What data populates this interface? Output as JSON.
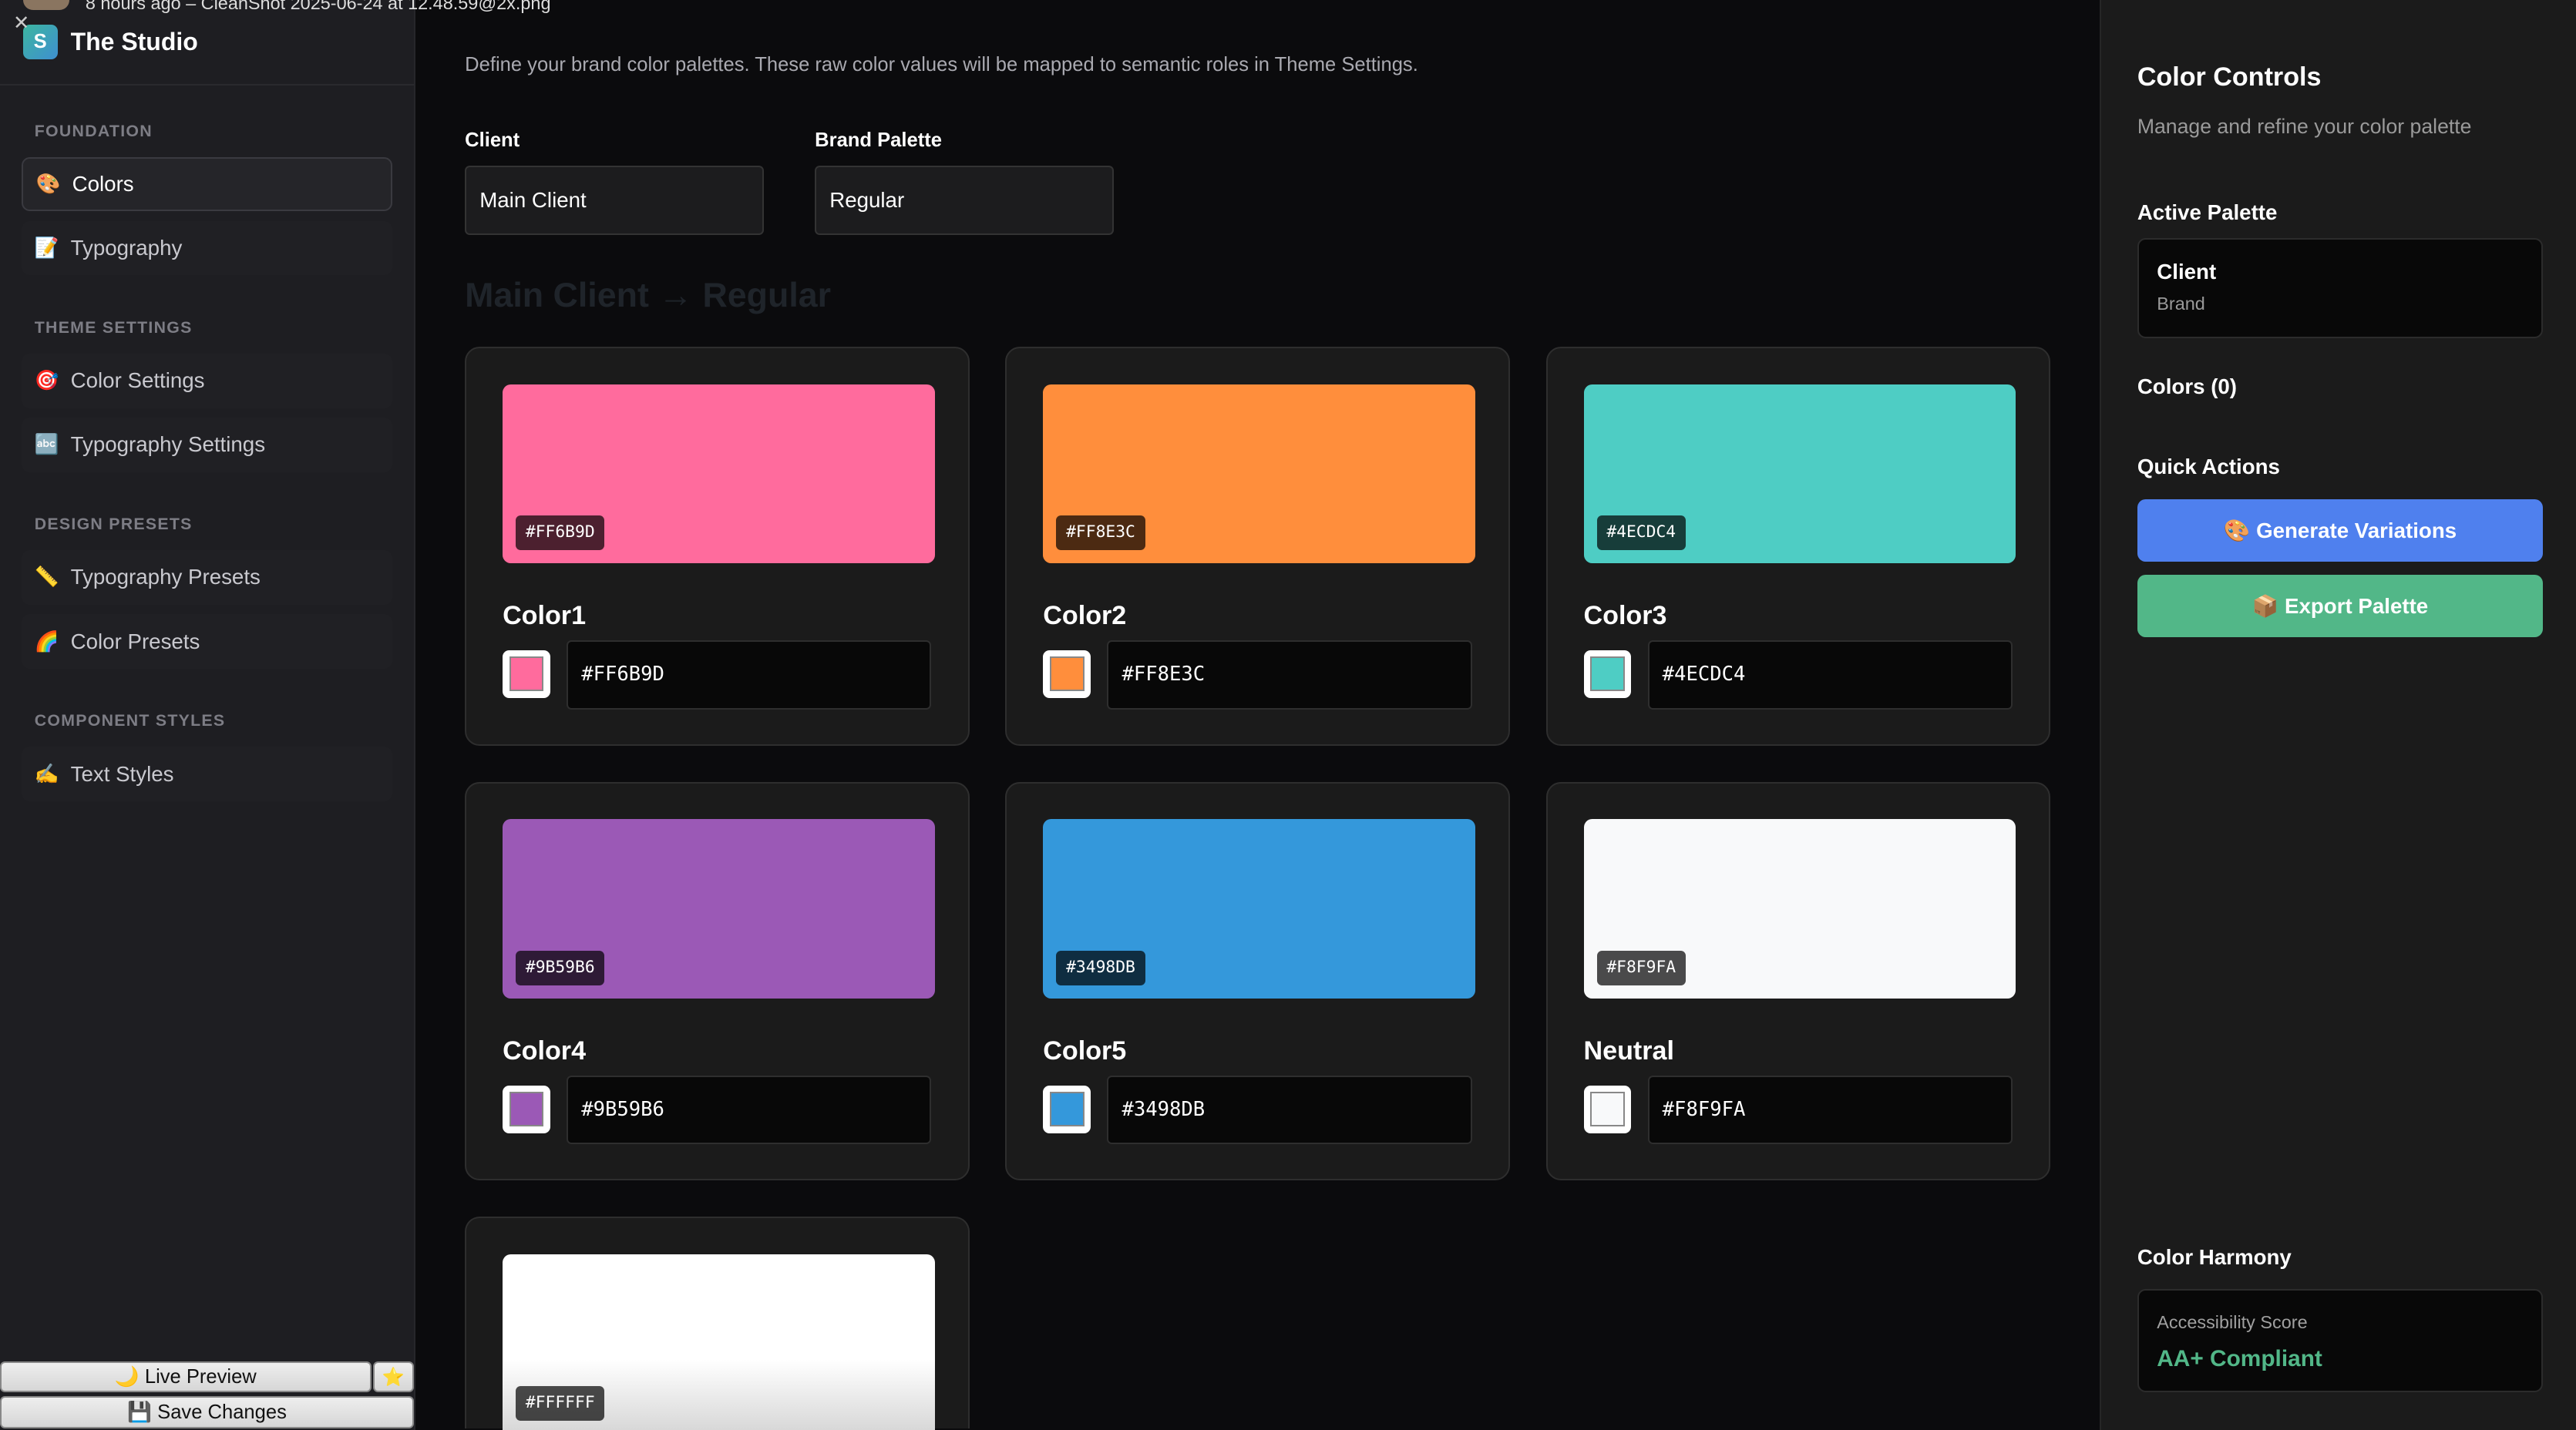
{
  "window": {
    "title": "8 hours ago – CleanShot 2025-06-24 at 12.48.59@2x.png"
  },
  "app": {
    "logo_letter": "S",
    "name": "The Studio"
  },
  "sidebar": {
    "sections": [
      {
        "title": "FOUNDATION",
        "items": [
          {
            "label": "Colors",
            "icon": "🎨",
            "icon_name": "palette-icon",
            "active": true
          },
          {
            "label": "Typography",
            "icon": "📝",
            "icon_name": "memo-icon"
          }
        ]
      },
      {
        "title": "THEME SETTINGS",
        "items": [
          {
            "label": "Color Settings",
            "icon": "🎯",
            "icon_name": "target-icon"
          },
          {
            "label": "Typography Settings",
            "icon": "🔤",
            "icon_name": "abc-icon"
          }
        ]
      },
      {
        "title": "DESIGN PRESETS",
        "items": [
          {
            "label": "Typography Presets",
            "icon": "📏",
            "icon_name": "ruler-icon"
          },
          {
            "label": "Color Presets",
            "icon": "🌈",
            "icon_name": "rainbow-icon"
          }
        ]
      },
      {
        "title": "COMPONENT STYLES",
        "items": [
          {
            "label": "Text Styles",
            "icon": "✍️",
            "icon_name": "writing-hand-icon"
          }
        ]
      }
    ],
    "live_preview": "🌙 Live Preview",
    "star": "⭐",
    "save": "💾 Save Changes"
  },
  "main": {
    "description": "Define your brand color palettes. These raw color values will be mapped to semantic roles in Theme Settings.",
    "client_label": "Client",
    "client_value": "Main Client",
    "palette_label": "Brand Palette",
    "palette_value": "Regular",
    "breadcrumb": "Main Client → Regular",
    "colors": [
      {
        "name": "Color1",
        "hex": "#FF6B9D"
      },
      {
        "name": "Color2",
        "hex": "#FF8E3C"
      },
      {
        "name": "Color3",
        "hex": "#4ECDC4"
      },
      {
        "name": "Color4",
        "hex": "#9B59B6"
      },
      {
        "name": "Color5",
        "hex": "#3498DB"
      },
      {
        "name": "Neutral",
        "hex": "#F8F9FA"
      },
      {
        "name": "",
        "hex": "#FFFFFF"
      }
    ]
  },
  "panel": {
    "title": "Color Controls",
    "subtitle": "Manage and refine your color palette",
    "active_palette_heading": "Active Palette",
    "active_palette_name": "Client",
    "active_palette_type": "Brand",
    "colors_count": "Colors (0)",
    "quick_actions": "Quick Actions",
    "generate": "🎨 Generate Variations",
    "export": "📦 Export Palette",
    "harmony_heading": "Color Harmony",
    "accessibility_label": "Accessibility Score",
    "accessibility_value": "AA+ Compliant",
    "colors": {
      "generate_bg": "#4F80EE",
      "export_bg": "#52B788",
      "compliant": "#52B788"
    }
  }
}
